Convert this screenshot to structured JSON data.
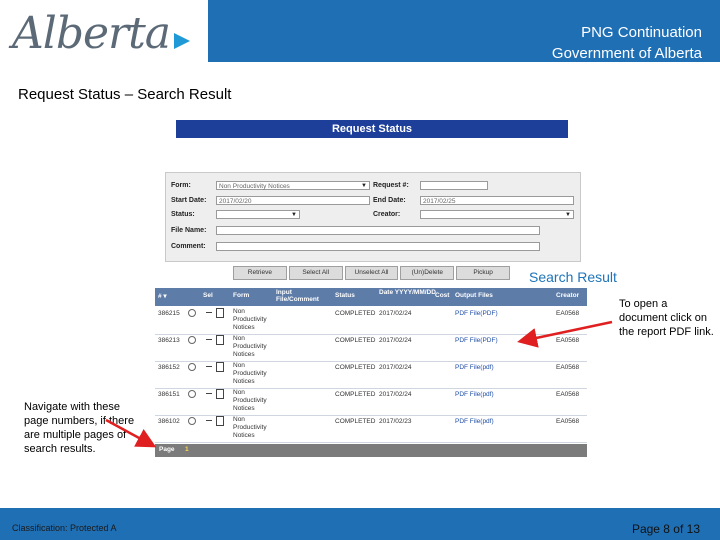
{
  "header": {
    "logo_text": "Alberta",
    "title_line1": "PNG Continuation",
    "title_line2": "Government of Alberta",
    "accent_color": "#1f6fb5"
  },
  "slide": {
    "title": "Request Status – Search Result",
    "search_result_label": "Search Result",
    "note_right": "To open a document click on the report PDF link.",
    "note_left": "Navigate with these page numbers, if there are multiple pages of search results."
  },
  "screenshot": {
    "banner": "Request Status",
    "form": {
      "form_label": "Form:",
      "form_value": "Non Productivity Notices",
      "request_label": "Request #:",
      "start_label": "Start Date:",
      "start_value": "2017/02/20",
      "end_label": "End Date:",
      "end_value": "2017/02/25",
      "status_label": "Status:",
      "creator_label": "Creator:",
      "filename_label": "File Name:",
      "comment_label": "Comment:"
    },
    "buttons": [
      "Retrieve",
      "Select All",
      "Unselect All",
      "(Un)Delete",
      "Pickup"
    ],
    "table": {
      "headers": [
        "# ▾",
        "Sel",
        "Form",
        "Input File/Comment",
        "Status",
        "Date YYYY/MM/DD",
        "Cost",
        "Output Files",
        "Creator"
      ],
      "rows": [
        {
          "id": "386215",
          "form": "Non Productivity Notices",
          "status": "COMPLETED",
          "date": "2017/02/24",
          "output": "PDF File(PDF)",
          "creator": "EA0568"
        },
        {
          "id": "386213",
          "form": "Non Productivity Notices",
          "status": "COMPLETED",
          "date": "2017/02/24",
          "output": "PDF File(PDF)",
          "creator": "EA0568"
        },
        {
          "id": "386152",
          "form": "Non Productivity Notices",
          "status": "COMPLETED",
          "date": "2017/02/24",
          "output": "PDF File(pdf)",
          "creator": "EA0568"
        },
        {
          "id": "386151",
          "form": "Non Productivity Notices",
          "status": "COMPLETED",
          "date": "2017/02/24",
          "output": "PDF File(pdf)",
          "creator": "EA0568"
        },
        {
          "id": "386102",
          "form": "Non Productivity Notices",
          "status": "COMPLETED",
          "date": "2017/02/23",
          "output": "PDF File(pdf)",
          "creator": "EA0568"
        }
      ],
      "page_label": "Page",
      "page_number": "1"
    }
  },
  "footer": {
    "classification": "Classification: Protected A",
    "page": "Page 8 of 13"
  }
}
